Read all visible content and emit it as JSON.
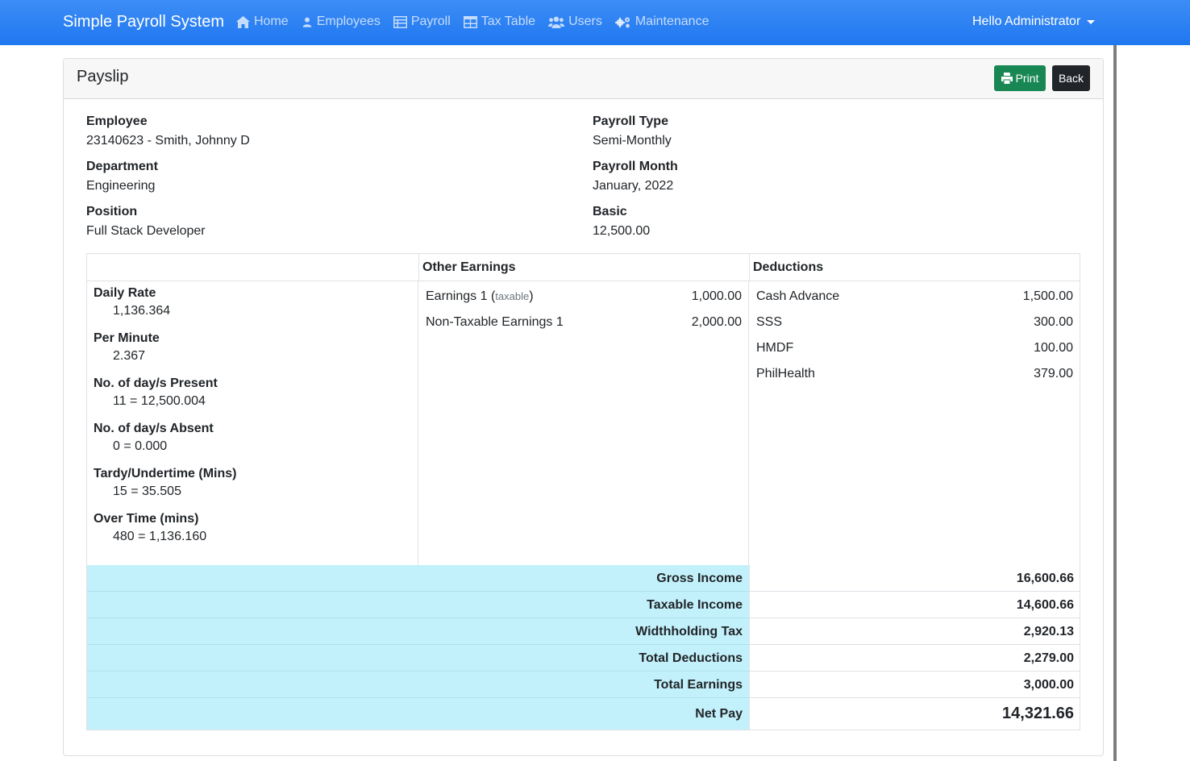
{
  "navbar": {
    "brand": "Simple Payroll System",
    "items": [
      {
        "label": "Home",
        "icon": "home-icon"
      },
      {
        "label": "Employees",
        "icon": "user-icon"
      },
      {
        "label": "Payroll",
        "icon": "table-list-icon"
      },
      {
        "label": "Tax Table",
        "icon": "table-icon"
      },
      {
        "label": "Users",
        "icon": "users-icon"
      },
      {
        "label": "Maintenance",
        "icon": "gears-icon"
      }
    ],
    "user_greeting": "Hello Administrator"
  },
  "card": {
    "title": "Payslip",
    "print_label": "Print",
    "back_label": "Back"
  },
  "info": {
    "employee_label": "Employee",
    "employee_value": "23140623 - Smith, Johnny D",
    "department_label": "Department",
    "department_value": "Engineering",
    "position_label": "Position",
    "position_value": "Full Stack Developer",
    "payroll_type_label": "Payroll Type",
    "payroll_type_value": "Semi-Monthly",
    "payroll_month_label": "Payroll Month",
    "payroll_month_value": "January, 2022",
    "basic_label": "Basic",
    "basic_value": "12,500.00"
  },
  "table": {
    "other_earnings_header": "Other Earnings",
    "deductions_header": "Deductions",
    "attendance": [
      {
        "label": "Daily Rate",
        "value": "1,136.364"
      },
      {
        "label": "Per Minute",
        "value": "2.367"
      },
      {
        "label": "No. of day/s Present",
        "value": "11 = 12,500.004"
      },
      {
        "label": "No. of day/s Absent",
        "value": "0 = 0.000"
      },
      {
        "label": "Tardy/Undertime (Mins)",
        "value": "15 = 35.505"
      },
      {
        "label": "Over Time (mins)",
        "value": "480 = 1,136.160"
      }
    ],
    "earnings": [
      {
        "name": "Earnings 1",
        "tag": "taxable",
        "amount": "1,000.00"
      },
      {
        "name": "Non-Taxable Earnings 1",
        "tag": "",
        "amount": "2,000.00"
      }
    ],
    "deductions": [
      {
        "name": "Cash Advance",
        "amount": "1,500.00"
      },
      {
        "name": "SSS",
        "amount": "300.00"
      },
      {
        "name": "HMDF",
        "amount": "100.00"
      },
      {
        "name": "PhilHealth",
        "amount": "379.00"
      }
    ],
    "summary": [
      {
        "label": "Gross Income",
        "value": "16,600.66"
      },
      {
        "label": "Taxable Income",
        "value": "14,600.66"
      },
      {
        "label": "Widthholding Tax",
        "value": "2,920.13"
      },
      {
        "label": "Total Deductions",
        "value": "2,279.00"
      },
      {
        "label": "Total Earnings",
        "value": "3,000.00"
      },
      {
        "label": "Net Pay",
        "value": "14,321.66"
      }
    ]
  }
}
